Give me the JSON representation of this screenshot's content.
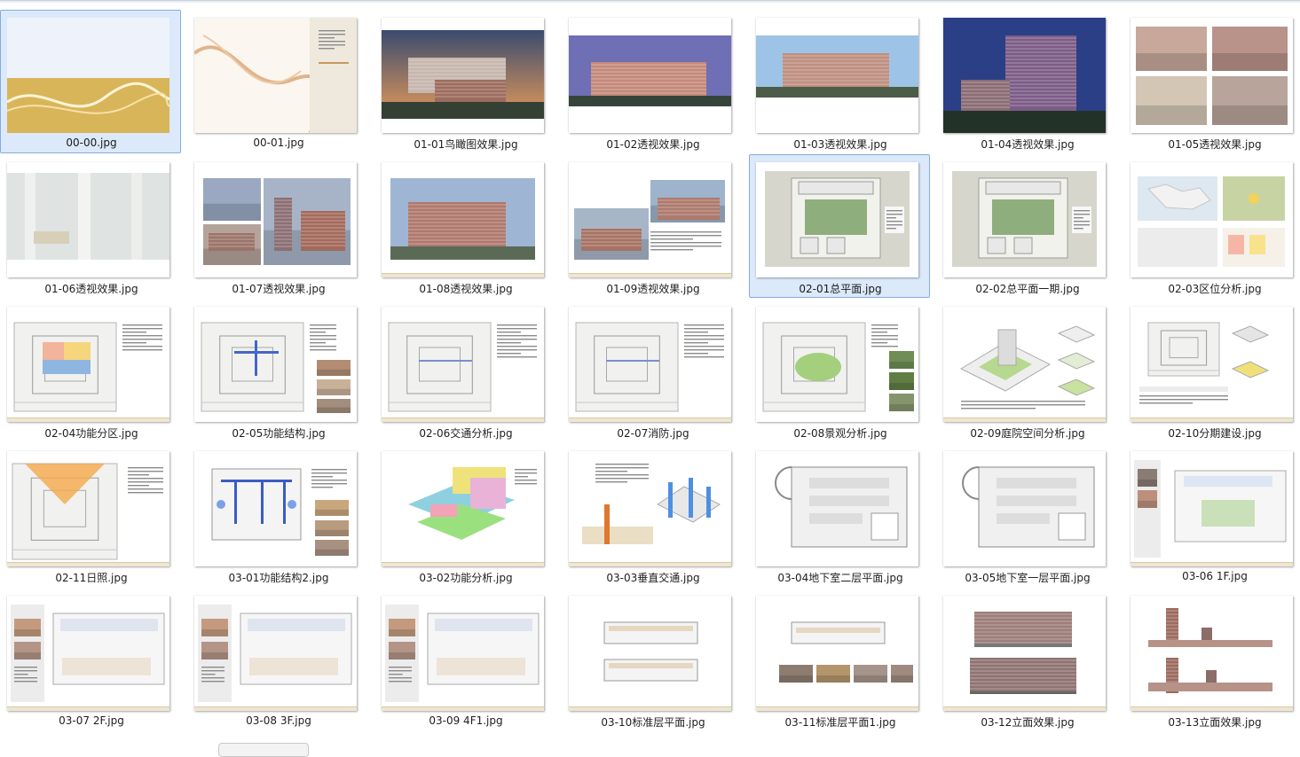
{
  "files": [
    {
      "name": "00-00.jpg",
      "kind": "banner",
      "selected": true
    },
    {
      "name": "00-01.jpg",
      "kind": "cover",
      "selected": false
    },
    {
      "name": "01-01鸟瞰图效果.jpg",
      "kind": "render-dusk",
      "selected": false
    },
    {
      "name": "01-02透视效果.jpg",
      "kind": "render-purple",
      "selected": false
    },
    {
      "name": "01-03透视效果.jpg",
      "kind": "render-day",
      "selected": false
    },
    {
      "name": "01-04透视效果.jpg",
      "kind": "render-blue",
      "selected": false
    },
    {
      "name": "01-05透视效果.jpg",
      "kind": "interior-collage",
      "selected": false
    },
    {
      "name": "01-06透视效果.jpg",
      "kind": "interior-lobby",
      "selected": false
    },
    {
      "name": "01-07透视效果.jpg",
      "kind": "render-collage",
      "selected": false
    },
    {
      "name": "01-08透视效果.jpg",
      "kind": "render-single",
      "selected": false
    },
    {
      "name": "01-09透视效果.jpg",
      "kind": "render-collage2",
      "selected": false
    },
    {
      "name": "02-01总平面.jpg",
      "kind": "siteplan",
      "selected": true
    },
    {
      "name": "02-02总平面一期.jpg",
      "kind": "siteplan",
      "selected": false
    },
    {
      "name": "02-03区位分析.jpg",
      "kind": "location",
      "selected": false
    },
    {
      "name": "02-04功能分区.jpg",
      "kind": "plan-zones",
      "selected": false
    },
    {
      "name": "02-05功能结构.jpg",
      "kind": "plan-photos",
      "selected": false
    },
    {
      "name": "02-06交通分析.jpg",
      "kind": "plan-text",
      "selected": false
    },
    {
      "name": "02-07消防.jpg",
      "kind": "plan-text",
      "selected": false
    },
    {
      "name": "02-08景观分析.jpg",
      "kind": "plan-green",
      "selected": false
    },
    {
      "name": "02-09庭院空间分析.jpg",
      "kind": "axon",
      "selected": false
    },
    {
      "name": "02-10分期建设.jpg",
      "kind": "phasing",
      "selected": false
    },
    {
      "name": "02-11日照.jpg",
      "kind": "sun",
      "selected": false
    },
    {
      "name": "03-01功能结构2.jpg",
      "kind": "structure",
      "selected": false
    },
    {
      "name": "03-02功能分析.jpg",
      "kind": "massing",
      "selected": false
    },
    {
      "name": "03-03垂直交通.jpg",
      "kind": "vertical",
      "selected": false
    },
    {
      "name": "03-04地下室二层平面.jpg",
      "kind": "basement",
      "selected": false
    },
    {
      "name": "03-05地下室一层平面.jpg",
      "kind": "basement",
      "selected": false
    },
    {
      "name": "03-06 1F.jpg",
      "kind": "floorplan-photos",
      "selected": false
    },
    {
      "name": "03-07 2F.jpg",
      "kind": "floorplan-side",
      "selected": false
    },
    {
      "name": "03-08 3F.jpg",
      "kind": "floorplan-side",
      "selected": false
    },
    {
      "name": "03-09 4F1.jpg",
      "kind": "floorplan-side",
      "selected": false
    },
    {
      "name": "03-10标准层平面.jpg",
      "kind": "standard",
      "selected": false
    },
    {
      "name": "03-11标准层平面1.jpg",
      "kind": "standard-photos",
      "selected": false
    },
    {
      "name": "03-12立面效果.jpg",
      "kind": "elevation",
      "selected": false
    },
    {
      "name": "03-13立面效果.jpg",
      "kind": "elevation2",
      "selected": false
    }
  ]
}
